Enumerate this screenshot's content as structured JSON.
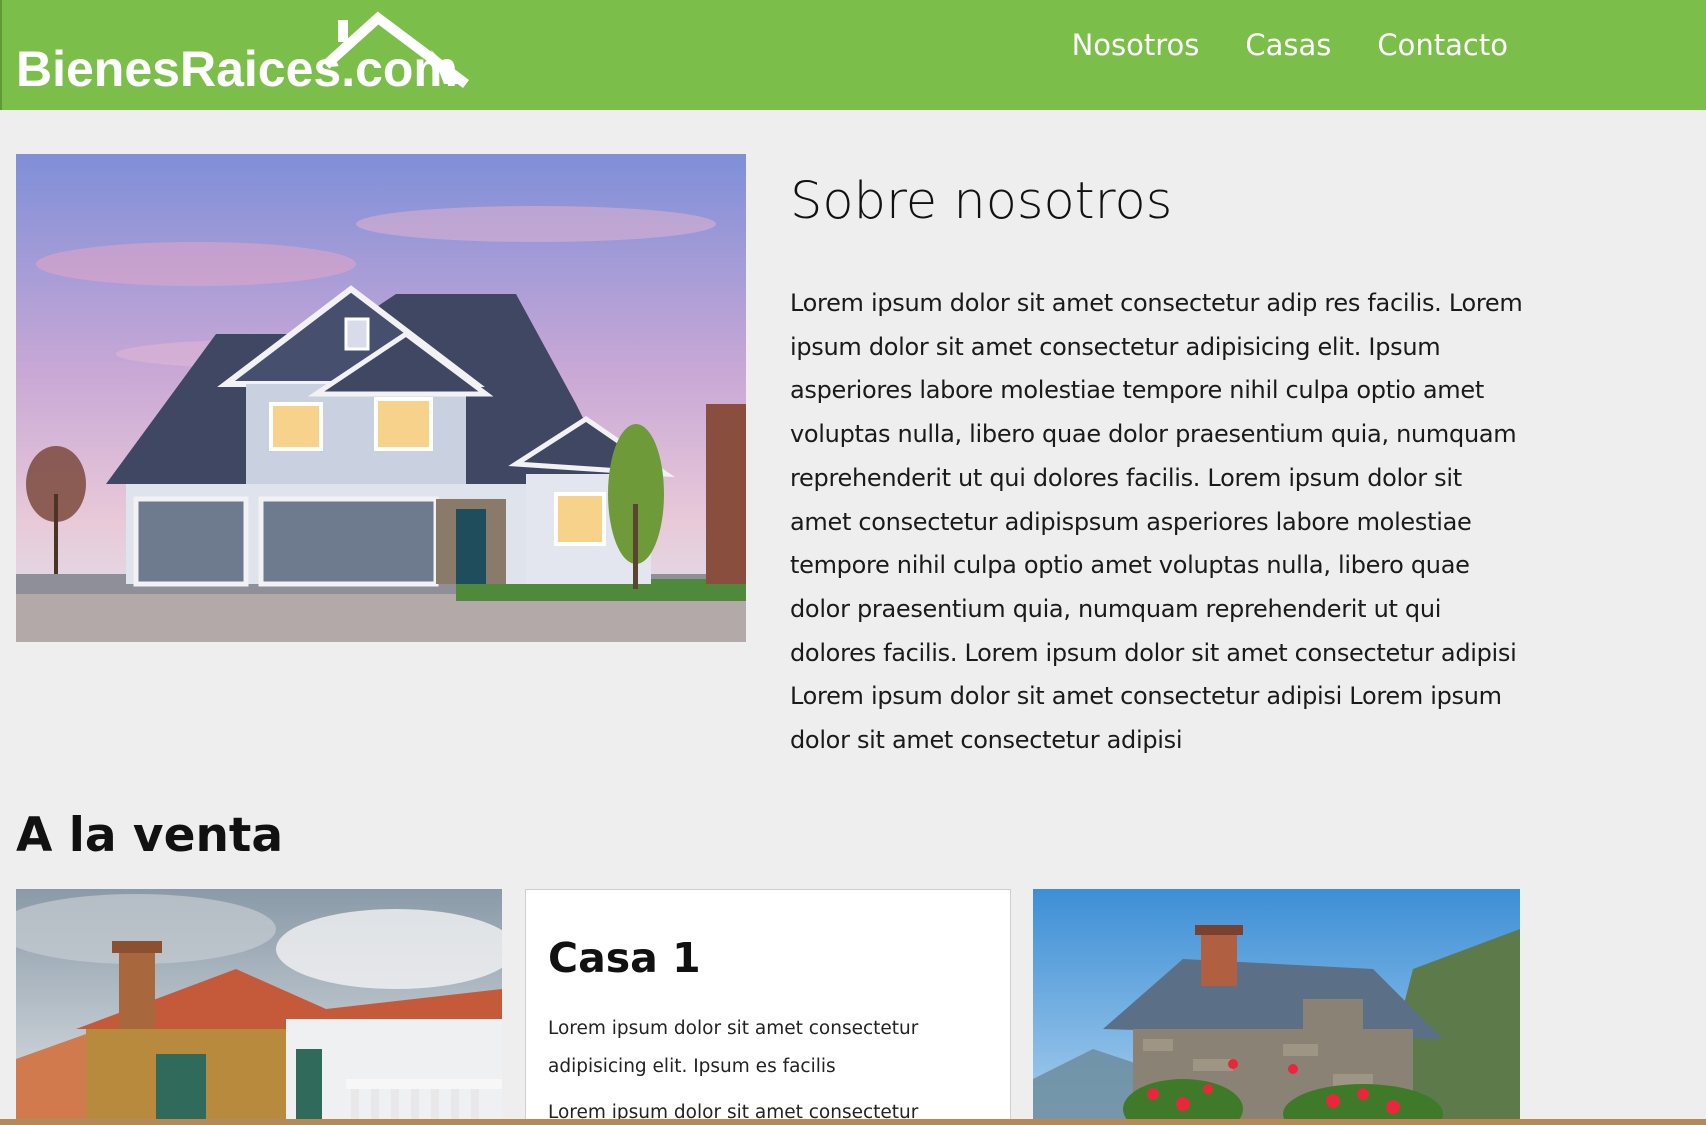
{
  "header": {
    "logo_text": "BienesRaices.com",
    "nav": [
      "Nosotros",
      "Casas",
      "Contacto"
    ],
    "color": "#7bbf4a"
  },
  "about": {
    "title": "Sobre nosotros",
    "text": "Lorem ipsum dolor sit amet consectetur adip res facilis. Lorem ipsum dolor sit amet consectetur adipisicing elit. Ipsum asperiores labore molestiae tempore nihil culpa optio amet voluptas nulla, libero quae dolor praesentium quia, numquam reprehenderit ut qui dolores facilis. Lorem ipsum dolor sit amet consectetur adipispsum asperiores labore molestiae tempore nihil culpa optio amet voluptas nulla, libero quae dolor praesentium quia, numquam reprehenderit ut qui dolores facilis. Lorem ipsum dolor sit amet consectetur adipisi Lorem ipsum dolor sit amet consectetur adipisi Lorem ipsum dolor sit amet consectetur adipisi",
    "image_icon": "house-photo"
  },
  "sale": {
    "title": "A la venta",
    "card": {
      "title": "Casa 1",
      "text": "Lorem ipsum dolor sit amet consectetur adipisicing elit. Ipsum es facilis",
      "text2": "Lorem ipsum dolor sit amet consectetur"
    },
    "images": [
      "mediterranean-house-photo",
      "stone-cottage-photo"
    ]
  }
}
